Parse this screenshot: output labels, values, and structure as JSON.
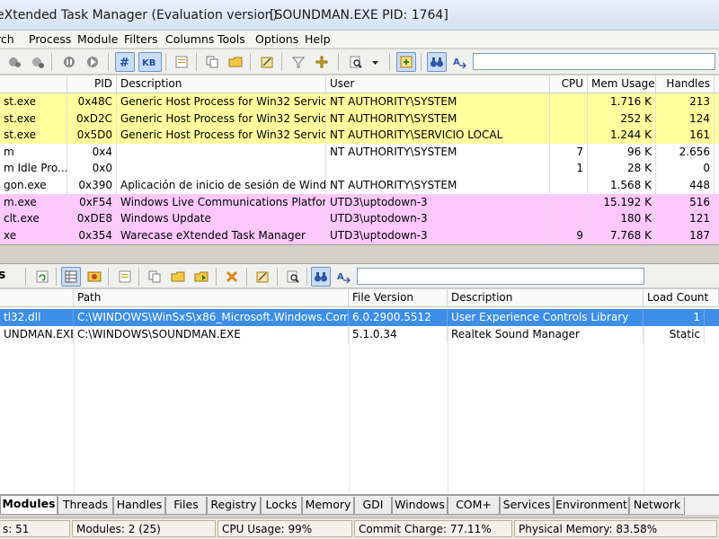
{
  "title": {
    "app": "eXtended Task Manager (Evaluation version)",
    "process": "[SOUNDMAN.EXE    PID: 1764]"
  },
  "menu": [
    "rch",
    "Process",
    "Module",
    "Filters",
    "Columns",
    "Tools",
    "Options",
    "Help"
  ],
  "toolbar_top": {
    "search_value": ""
  },
  "process_table": {
    "columns": [
      "",
      "PID",
      "Description",
      "User",
      "CPU",
      "Mem Usage",
      "Handles"
    ],
    "rows": [
      {
        "name": "st.exe",
        "pid": "0x48C",
        "desc": "Generic Host Process for Win32 Services",
        "user": "NT AUTHORITY\\SYSTEM",
        "cpu": "",
        "mem": "1.716 K",
        "handles": "213",
        "color": "#ffff9e"
      },
      {
        "name": "st.exe",
        "pid": "0xD2C",
        "desc": "Generic Host Process for Win32 Services",
        "user": "NT AUTHORITY\\SYSTEM",
        "cpu": "",
        "mem": "252 K",
        "handles": "124",
        "color": "#ffff9e"
      },
      {
        "name": "st.exe",
        "pid": "0x5D0",
        "desc": "Generic Host Process for Win32 Services",
        "user": "NT AUTHORITY\\SERVICIO LOCAL",
        "cpu": "",
        "mem": "1.244 K",
        "handles": "161",
        "color": "#ffff9e"
      },
      {
        "name": "m",
        "pid": "0x4",
        "desc": "",
        "user": "NT AUTHORITY\\SYSTEM",
        "cpu": "7",
        "mem": "96 K",
        "handles": "2.656",
        "color": "#ffffff"
      },
      {
        "name": "m Idle Pro...",
        "pid": "0x0",
        "desc": "",
        "user": "",
        "cpu": "1",
        "mem": "28 K",
        "handles": "0",
        "color": "#ffffff"
      },
      {
        "name": "gon.exe",
        "pid": "0x390",
        "desc": "Aplicación de inicio de sesión de Wind...",
        "user": "NT AUTHORITY\\SYSTEM",
        "cpu": "",
        "mem": "1.568 K",
        "handles": "448",
        "color": "#ffffff"
      },
      {
        "name": "m.exe",
        "pid": "0xF54",
        "desc": "Windows Live Communications Platform",
        "user": "UTD3\\uptodown-3",
        "cpu": "",
        "mem": "15.192 K",
        "handles": "516",
        "color": "#ffc8ff"
      },
      {
        "name": "clt.exe",
        "pid": "0xDE8",
        "desc": "Windows Update",
        "user": "UTD3\\uptodown-3",
        "cpu": "",
        "mem": "180 K",
        "handles": "121",
        "color": "#ffc8ff"
      },
      {
        "name": "xe",
        "pid": "0x354",
        "desc": "Warecase eXtended Task Manager",
        "user": "UTD3\\uptodown-3",
        "cpu": "9",
        "mem": "7.768 K",
        "handles": "187",
        "color": "#ffc8ff"
      }
    ]
  },
  "toolbar_bottom": {
    "label": "s",
    "search_value": ""
  },
  "module_table": {
    "columns": [
      "",
      "Path",
      "File Version",
      "Description",
      "Load Count"
    ],
    "rows": [
      {
        "name": "tl32.dll",
        "path": "C:\\WINDOWS\\WinSxS\\x86_Microsoft.Windows.Com...",
        "version": "6.0.2900.5512",
        "desc": "User Experience Controls Library",
        "load": "1",
        "selected": true
      },
      {
        "name": "UNDMAN.EXE",
        "path": "C:\\WINDOWS\\SOUNDMAN.EXE",
        "version": "5.1.0.34",
        "desc": "Realtek Sound Manager",
        "load": "Static",
        "selected": false
      }
    ]
  },
  "tabs": [
    "Modules",
    "Threads",
    "Handles",
    "Files",
    "Registry",
    "Locks",
    "Memory",
    "GDI",
    "Windows",
    "COM+",
    "Services",
    "Environment",
    "Network"
  ],
  "active_tab": "Modules",
  "status": {
    "processes": "s: 51",
    "modules": "Modules: 2 (25)",
    "cpu": "CPU Usage: 99%",
    "commit": "Commit Charge: 77.11%",
    "physical": "Physical Memory: 83.58%"
  },
  "colors": {
    "service_row": "#ffff9e",
    "user_row": "#ffc8ff",
    "selected_row": "#3d8ee8",
    "toggle_on": "#c9dcf5"
  },
  "icons": {
    "toolbar_top": [
      "kill-process-icon",
      "kill-tree-icon",
      "suspend-icon",
      "resume-icon",
      "hex-toggle-icon",
      "kb-toggle-icon",
      "properties-icon",
      "copy-icon",
      "open-folder-icon",
      "save-icon",
      "filter-icon",
      "add-filter-icon",
      "find-icon",
      "dropdown-icon",
      "refresh-icon",
      "find-binoculars-icon",
      "find-next-icon"
    ],
    "toolbar_bottom": [
      "refresh-icon",
      "grid-view-icon",
      "tree-view-icon",
      "properties-icon",
      "copy-icon",
      "open-folder-icon",
      "export-icon",
      "unload-icon",
      "save-icon",
      "find-icon",
      "find-binoculars-icon",
      "find-next-icon"
    ]
  }
}
